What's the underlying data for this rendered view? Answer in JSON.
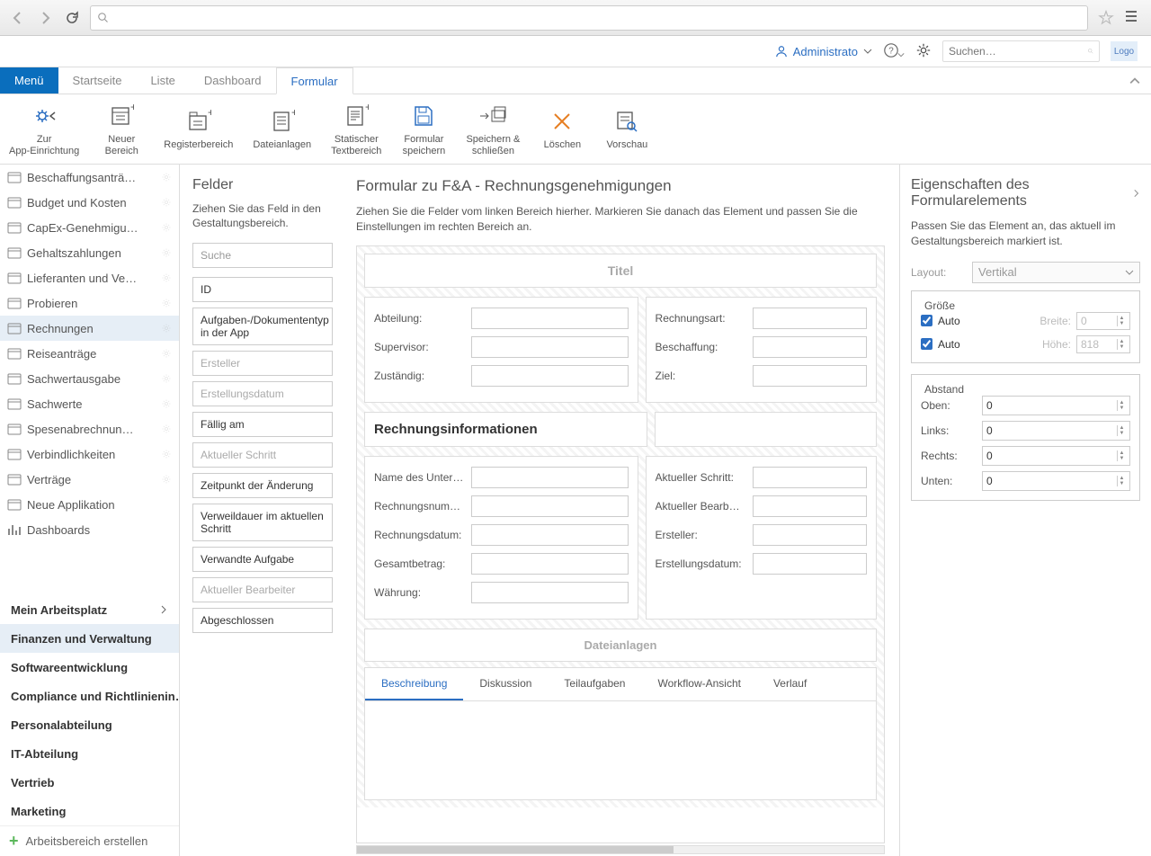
{
  "header": {
    "user": "Administrato",
    "search_placeholder": "Suchen…",
    "logo": "Logo"
  },
  "tabs": {
    "menu": "Menü",
    "items": [
      "Startseite",
      "Liste",
      "Dashboard",
      "Formular"
    ],
    "active": "Formular"
  },
  "ribbon": [
    {
      "label": "Zur\nApp-Einrichtung"
    },
    {
      "label": "Neuer\nBereich"
    },
    {
      "label": "Registerbereich"
    },
    {
      "label": "Dateianlagen"
    },
    {
      "label": "Statischer\nTextbereich"
    },
    {
      "label": "Formular\nspeichern"
    },
    {
      "label": "Speichern &\nschließen"
    },
    {
      "label": "Löschen"
    },
    {
      "label": "Vorschau"
    }
  ],
  "sidebar": {
    "apps": [
      "Beschaffungsanträ…",
      "Budget und Kosten",
      "CapEx-Genehmigu…",
      "Gehaltszahlungen",
      "Lieferanten und Ve…",
      "Probieren",
      "Rechnungen",
      "Reiseanträge",
      "Sachwertausgabe",
      "Sachwerte",
      "Spesenabrechnun…",
      "Verbindlichkeiten",
      "Verträge",
      "Neue Applikation",
      "Dashboards"
    ],
    "selected": "Rechnungen",
    "sections": [
      {
        "label": "Mein Arbeitsplatz",
        "expand": true
      },
      {
        "label": "Finanzen und Verwaltung",
        "active": true
      },
      {
        "label": "Softwareentwicklung"
      },
      {
        "label": "Compliance und Richtlinienin…"
      },
      {
        "label": "Personalabteilung"
      },
      {
        "label": "IT-Abteilung"
      },
      {
        "label": "Vertrieb"
      },
      {
        "label": "Marketing"
      }
    ],
    "create": "Arbeitsbereich erstellen"
  },
  "fields": {
    "title": "Felder",
    "desc": "Ziehen Sie das Feld in den Gestaltungsbereich.",
    "search_placeholder": "Suche",
    "items": [
      {
        "label": "ID"
      },
      {
        "label": "Aufgaben-/Dokumententyp in der App"
      },
      {
        "label": "Ersteller",
        "faded": true
      },
      {
        "label": "Erstellungsdatum",
        "faded": true
      },
      {
        "label": "Fällig am"
      },
      {
        "label": "Aktueller Schritt",
        "faded": true
      },
      {
        "label": "Zeitpunkt der Änderung"
      },
      {
        "label": "Verweildauer im aktuellen Schritt"
      },
      {
        "label": "Verwandte Aufgabe"
      },
      {
        "label": "Aktueller Bearbeiter",
        "faded": true
      },
      {
        "label": "Abgeschlossen"
      }
    ]
  },
  "designer": {
    "title": "Formular zu F&A - Rechnungsgenehmigungen",
    "desc": "Ziehen Sie die Felder vom linken Bereich hierher. Markieren Sie danach das Element und passen Sie die Einstellungen im rechten Bereich an.",
    "title_box": "Titel",
    "block1_left": [
      "Abteilung:",
      "Supervisor:",
      "Zuständig:"
    ],
    "block1_right": [
      "Rechnungsart:",
      "Beschaffung:",
      "Ziel:"
    ],
    "section_title": "Rechnungsinformationen",
    "block2_left": [
      "Name des Unter…",
      "Rechnungsnum…",
      "Rechnungsdatum:",
      "Gesamtbetrag:",
      "Währung:"
    ],
    "block2_right": [
      "Aktueller Schritt:",
      "Aktueller Bearbe…",
      "Ersteller:",
      "Erstellungsdatum:"
    ],
    "attach": "Dateianlagen",
    "tabs": [
      "Beschreibung",
      "Diskussion",
      "Teilaufgaben",
      "Workflow-Ansicht",
      "Verlauf"
    ],
    "active_tab": "Beschreibung"
  },
  "props": {
    "title": "Eigenschaften des Formularelements",
    "desc": "Passen Sie das Element an, das aktuell im Gestaltungsbereich markiert ist.",
    "layout_label": "Layout:",
    "layout_value": "Vertikal",
    "size_legend": "Größe",
    "auto": "Auto",
    "width_label": "Breite:",
    "width_value": "0",
    "height_label": "Höhe:",
    "height_value": "818",
    "margin_legend": "Abstand",
    "margins": [
      {
        "label": "Oben:",
        "value": "0"
      },
      {
        "label": "Links:",
        "value": "0"
      },
      {
        "label": "Rechts:",
        "value": "0"
      },
      {
        "label": "Unten:",
        "value": "0"
      }
    ]
  }
}
